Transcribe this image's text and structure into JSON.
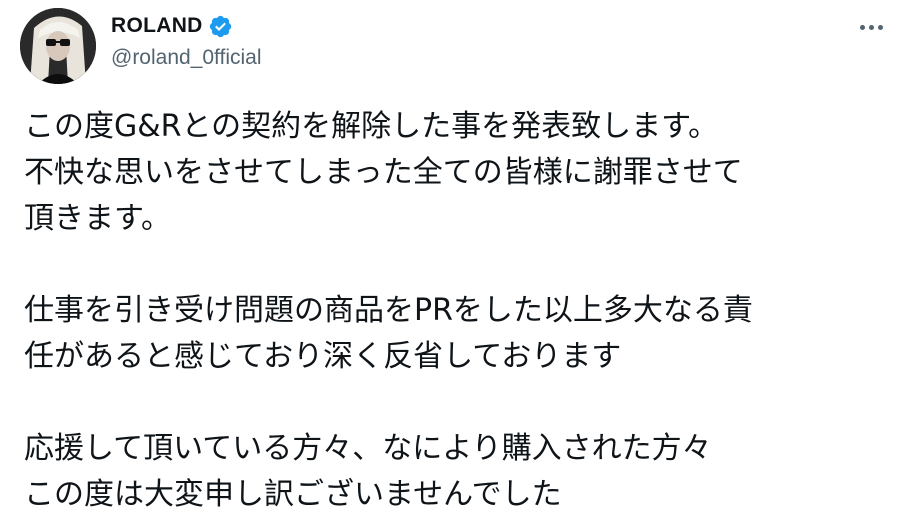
{
  "user": {
    "display_name": "ROLAND",
    "handle": "@roland_0fficial",
    "verified": true,
    "verified_icon": "verified-badge-icon",
    "accent_color": "#1d9bf0"
  },
  "menu": {
    "icon": "more-dots-icon"
  },
  "tweet": {
    "paragraphs": [
      {
        "lines": [
          "この度G&Rとの契約を解除した事を発表致します。",
          "不快な思いをさせてしまった全ての皆様に謝罪させて",
          "頂きます。"
        ]
      },
      {
        "lines": [
          "仕事を引き受け問題の商品をPRをした以上多大なる責",
          "任があると感じており深く反省しております"
        ]
      },
      {
        "lines": [
          "応援して頂いている方々、なにより購入された方々",
          "この度は大変申し訳ございませんでした"
        ]
      }
    ]
  }
}
